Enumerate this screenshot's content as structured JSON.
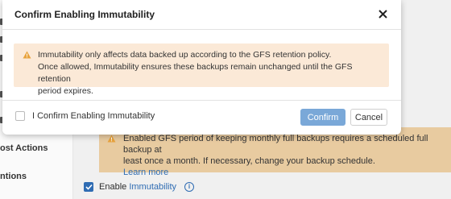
{
  "background": {
    "sidebar_items": [
      "ost Actions",
      "ntions"
    ],
    "warning_lines": [
      "Enabled GFS period of keeping monthly full backups requires a scheduled full backup at",
      "least once a month. If necessary, change your backup schedule."
    ],
    "learn_more": "Learn more",
    "enable_prefix": "Enable",
    "enable_link": "Immutability",
    "enable_checked": true
  },
  "modal": {
    "title": "Confirm Enabling Immutability",
    "notice_lines": [
      "Immutability only affects data backed up according to the GFS retention policy.",
      "Once allowed, Immutability ensures these backups remain unchanged until the GFS retention",
      "period expires."
    ],
    "checkbox_label": "I Confirm Enabling Immutability",
    "checkbox_checked": false,
    "confirm_label": "Confirm",
    "cancel_label": "Cancel"
  },
  "colors": {
    "accent": "#2f6cb3",
    "confirm_button": "#7aa8d8",
    "notice_bg": "#fbe9d7",
    "warning_bg": "#e8cba0",
    "warning_icon": "#e8a33d"
  },
  "icons": [
    "warning-icon",
    "close-icon",
    "checkmark-icon",
    "info-icon"
  ]
}
